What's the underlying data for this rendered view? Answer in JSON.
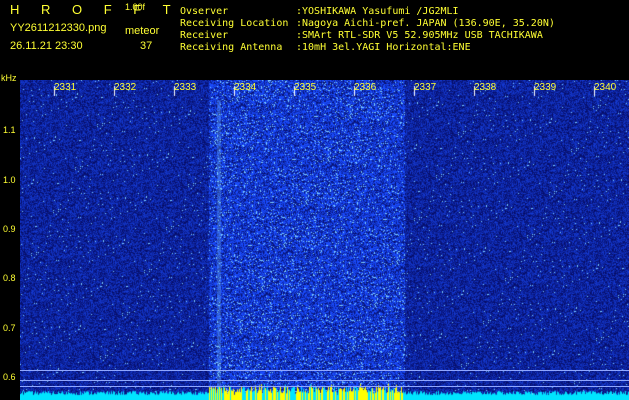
{
  "header": {
    "title": "H R O F F T",
    "version": "1.00f",
    "filename": "YY2611212330.png",
    "meteor_label": "meteor",
    "datetime": "26.11.21 23:30",
    "meteor_count": "37"
  },
  "station": [
    {
      "key": "Ovserver",
      "value": ":YOSHIKAWA Yasufumi /JG2MLI"
    },
    {
      "key": "Receiving Location",
      "value": ":Nagoya Aichi-pref. JAPAN (136.90E, 35.20N)"
    },
    {
      "key": "Receiver",
      "value": ":SMArt RTL-SDR V5 52.905MHz USB TACHIKAWA"
    },
    {
      "key": "Receiving Antenna",
      "value": ":10mH 3el.YAGI Horizontal:ENE"
    }
  ],
  "axis": {
    "unit": "kHz",
    "y_ticks": [
      "1.1",
      "1.0",
      "0.9",
      "0.8",
      "0.7",
      "0.6"
    ],
    "x_ticks": [
      "2331",
      "2332",
      "2333",
      "2334",
      "2335",
      "2336",
      "2337",
      "2338",
      "2339",
      "2340"
    ]
  },
  "colors": {
    "background": "#000000",
    "text": "#ffff33",
    "noise_dark": "#050a60",
    "noise_bright": "#1a4cff",
    "spark": "#7fd0ff",
    "baseline": "#00e5ff",
    "burst": "#ffff00"
  },
  "band": {
    "start_minute": "2334",
    "end_minute": "2337"
  }
}
